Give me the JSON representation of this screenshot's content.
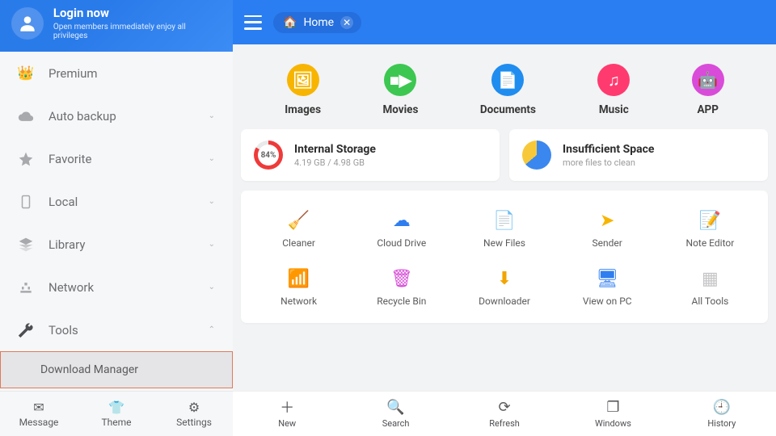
{
  "sidebar": {
    "login": {
      "title": "Login now",
      "subtitle": "Open members immediately enjoy all privileges"
    },
    "items": [
      {
        "id": "premium",
        "label": "Premium",
        "icon": "crown"
      },
      {
        "id": "auto-backup",
        "label": "Auto backup",
        "icon": "cloud",
        "chevron": true
      },
      {
        "id": "favorite",
        "label": "Favorite",
        "icon": "star",
        "chevron": true
      },
      {
        "id": "local",
        "label": "Local",
        "icon": "phone",
        "chevron": true
      },
      {
        "id": "library",
        "label": "Library",
        "icon": "layers",
        "chevron": true
      },
      {
        "id": "network",
        "label": "Network",
        "icon": "network",
        "chevron": true
      },
      {
        "id": "tools",
        "label": "Tools",
        "icon": "wrench",
        "chevron": true,
        "up": true
      }
    ],
    "subItem": {
      "label": "Download Manager"
    },
    "bottom": [
      {
        "id": "message",
        "label": "Message",
        "icon": "✉"
      },
      {
        "id": "theme",
        "label": "Theme",
        "icon": "👕"
      },
      {
        "id": "settings",
        "label": "Settings",
        "icon": "⚙"
      }
    ]
  },
  "header": {
    "tab": "Home"
  },
  "categories": [
    {
      "id": "images",
      "label": "Images",
      "glyph": "🖼",
      "cls": "c-img"
    },
    {
      "id": "movies",
      "label": "Movies",
      "glyph": "■▶",
      "cls": "c-mov"
    },
    {
      "id": "documents",
      "label": "Documents",
      "glyph": "📄",
      "cls": "c-doc"
    },
    {
      "id": "music",
      "label": "Music",
      "glyph": "♫",
      "cls": "c-mus"
    },
    {
      "id": "app",
      "label": "APP",
      "glyph": "🤖",
      "cls": "c-app"
    }
  ],
  "storage": {
    "internal": {
      "title": "Internal Storage",
      "subtitle": "4.19 GB / 4.98 GB",
      "percent": "84%"
    },
    "insufficient": {
      "title": "Insufficient Space",
      "subtitle": "more files to clean"
    }
  },
  "tools": {
    "row1": [
      {
        "id": "cleaner",
        "label": "Cleaner",
        "glyph": "🧹",
        "color": "#3ea3f0"
      },
      {
        "id": "cloud-drive",
        "label": "Cloud Drive",
        "glyph": "☁",
        "color": "#2f7ef0"
      },
      {
        "id": "new-files",
        "label": "New Files",
        "glyph": "📄",
        "color": "#2f7ef0"
      },
      {
        "id": "sender",
        "label": "Sender",
        "glyph": "➤",
        "color": "#f7b500"
      },
      {
        "id": "note-editor",
        "label": "Note Editor",
        "glyph": "📝",
        "color": "#2f7ef0"
      }
    ],
    "row2": [
      {
        "id": "network",
        "label": "Network",
        "glyph": "📶",
        "color": "#3cc751"
      },
      {
        "id": "recycle-bin",
        "label": "Recycle Bin",
        "glyph": "🗑",
        "color": "#d94bd9"
      },
      {
        "id": "downloader",
        "label": "Downloader",
        "glyph": "⬇",
        "color": "#f2a500"
      },
      {
        "id": "view-on-pc",
        "label": "View on PC",
        "glyph": "🖥",
        "color": "#2f7ef0"
      },
      {
        "id": "all-tools",
        "label": "All Tools",
        "glyph": "▦",
        "color": "#c5c5c7"
      }
    ]
  },
  "mainBottom": [
    {
      "id": "new",
      "label": "New",
      "glyph": "＋"
    },
    {
      "id": "search",
      "label": "Search",
      "glyph": "🔍"
    },
    {
      "id": "refresh",
      "label": "Refresh",
      "glyph": "⟳"
    },
    {
      "id": "windows",
      "label": "Windows",
      "glyph": "❐"
    },
    {
      "id": "history",
      "label": "History",
      "glyph": "🕘"
    }
  ]
}
